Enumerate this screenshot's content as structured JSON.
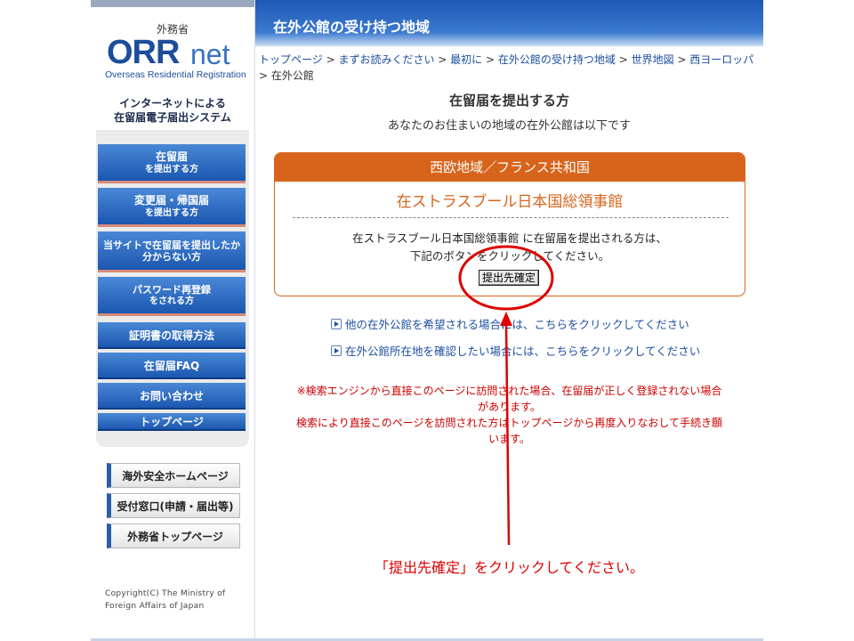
{
  "sidebar": {
    "ministry": "外務省",
    "logo_main": "ORR",
    "logo_net": "net",
    "logo_sub": "Overseas Residential Registration",
    "system_name_1": "インターネットによる",
    "system_name_2": "在留届電子届出システム",
    "nav": [
      {
        "l1": "在留届",
        "l2": "を提出する方"
      },
      {
        "l1": "変更届・帰国届",
        "l2": "を提出する方"
      },
      {
        "l1": "当サイトで在留届を提出したか",
        "l2": "分からない方"
      },
      {
        "l1": "パスワード再登録",
        "l2": "をされる方"
      },
      {
        "l1": "証明書の取得方法"
      },
      {
        "l1": "在留届FAQ"
      },
      {
        "l1": "お問い合わせ"
      },
      {
        "l1": "トップページ"
      }
    ],
    "external": [
      "海外安全ホームページ",
      "受付窓口(申請・届出等)",
      "外務省トップページ"
    ],
    "copyright_1": "Copyright(C)  The Ministry of",
    "copyright_2": "Foreign Affairs of Japan"
  },
  "header": {
    "title": "在外公館の受け持つ地域"
  },
  "breadcrumb": {
    "items": [
      "トップページ",
      "まずお読みください",
      "最初に",
      "在外公館の受け持つ地域",
      "世界地図",
      "西ヨーロッパ"
    ],
    "sep": " > ",
    "current": "在外公館"
  },
  "main": {
    "title": "在留届を提出する方",
    "subtitle": "あなたのお住まいの地域の在外公館は以下です",
    "region": "西欧地域／フランス共和国",
    "consulate": "在ストラスブール日本国総領事館",
    "instruction_1": "在ストラスブール日本国総領事館 に在留届を提出される方は、",
    "instruction_2": "下記のボタンをクリックしてください。",
    "confirm_button": "提出先確定",
    "link_other": "他の在外公館を希望される場合には、こちらをクリックしてください",
    "link_location": "在外公館所在地を確認したい場合には、こちらをクリックしてください",
    "warning_1a": "※検索エンジンから直接このページに訪問された場合、在留届が正しく登録されない場合",
    "warning_1b": "があります。",
    "warning_2a": "検索により直接このページを訪問された方はトップページから再度入りなおして手続き願",
    "warning_2b": "います。"
  },
  "annotation": {
    "text": "「提出先確定」をクリックしてください。",
    "color": "#dd0000"
  },
  "colors": {
    "nav_blue": "#1b57b0",
    "header_blue": "#1d58b6",
    "region_orange": "#d8641c",
    "link_blue": "#1d4fa0",
    "warning_red": "#cc0000"
  }
}
